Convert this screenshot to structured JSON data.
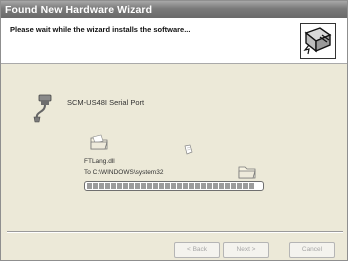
{
  "window": {
    "title": "Found New Hardware Wizard"
  },
  "header": {
    "title": "Please wait while the wizard installs the software...",
    "icon": "wizard-hardware-icon"
  },
  "device": {
    "icon": "serial-port-icon",
    "name": "SCM-US48I Serial Port"
  },
  "copy": {
    "source_icon": "folder-icon",
    "moving_icon": "document-icon",
    "dest_icon": "folder-icon",
    "file_name": "FTLang.dll",
    "destination": "To C:\\WINDOWS\\system32",
    "progress_percent": 100
  },
  "buttons": {
    "back_label": "< Back",
    "next_label": "Next >",
    "cancel_label": "Cancel"
  },
  "colors": {
    "window_bg": "#ece9d8",
    "title_bar": "#7a7a7a",
    "progress_fill": "#9c9c9c"
  }
}
